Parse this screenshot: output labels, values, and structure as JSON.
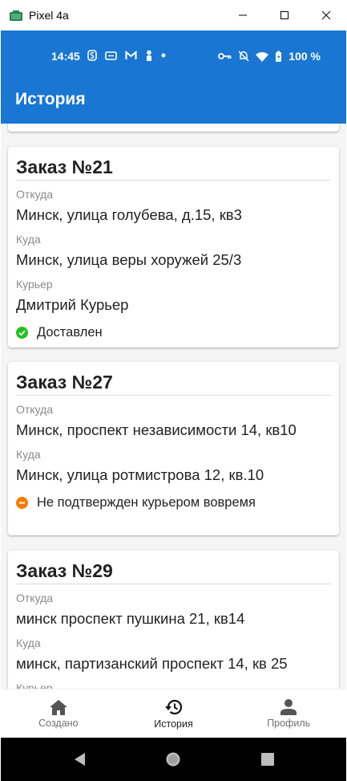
{
  "window": {
    "title": "Pixel 4a"
  },
  "status_bar": {
    "time": "14:45",
    "battery": "100 %"
  },
  "app_bar": {
    "title": "История"
  },
  "orders": [
    {
      "title": "Заказ №21",
      "from_label": "Откуда",
      "from": "Минск, улица голубева, д.15, кв3",
      "to_label": "Куда",
      "to": "Минск, улица веры хоружей 25/3",
      "courier_label": "Курьер",
      "courier": "Дмитрий Курьер",
      "status": "Доставлен",
      "status_color": "#22c022"
    },
    {
      "title": "Заказ №27",
      "from_label": "Откуда",
      "from": "Минск, проспект независимости 14, кв10",
      "to_label": "Куда",
      "to": "Минск, улица ротмистрова 12, кв.10",
      "status": "Не подтвержден курьером вовремя",
      "status_color": "#f57c00"
    },
    {
      "title": "Заказ №29",
      "from_label": "Откуда",
      "from": "минск проспект пушкина 21, кв14",
      "to_label": "Куда",
      "to": "минск, партизанский проспект 14, кв 25",
      "courier_label": "Курьер"
    }
  ],
  "bottom_nav": [
    {
      "label": "Создано",
      "icon": "home-icon"
    },
    {
      "label": "История",
      "icon": "history-icon",
      "active": true
    },
    {
      "label": "Профиль",
      "icon": "person-icon"
    }
  ]
}
